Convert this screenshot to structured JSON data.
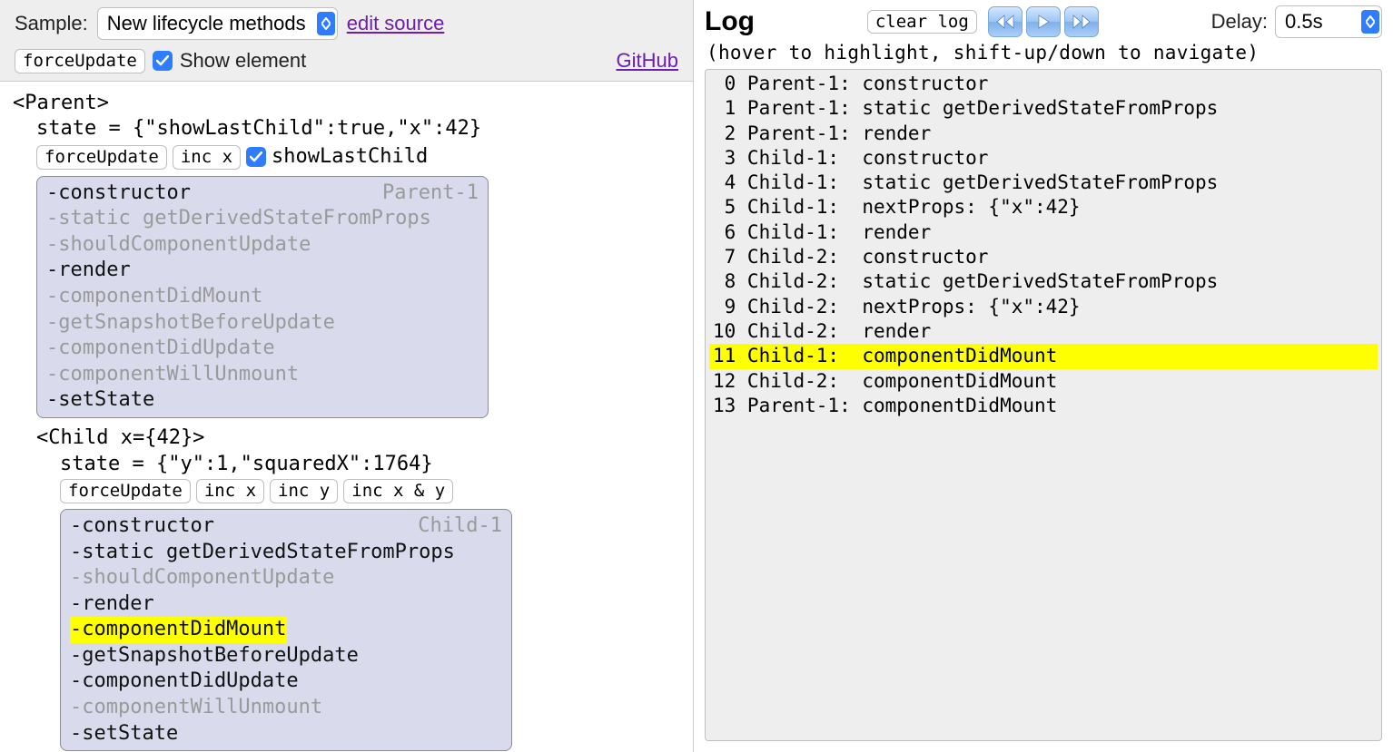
{
  "header": {
    "sample_label": "Sample:",
    "sample_value": "New lifecycle methods",
    "edit_source": "edit source",
    "force_update_btn": "forceUpdate",
    "show_element_label": "Show element",
    "github_link": "GitHub"
  },
  "tree": {
    "parent_open": "<Parent>",
    "parent_state": "state = {\"showLastChild\":true,\"x\":42}",
    "parent_force_update": "forceUpdate",
    "parent_inc_x": "inc x",
    "parent_show_last_child_label": "showLastChild",
    "parent_box_label": "Parent-1",
    "parent_methods": [
      {
        "text": "-constructor",
        "dim": false
      },
      {
        "text": "-static getDerivedStateFromProps",
        "dim": true
      },
      {
        "text": "-shouldComponentUpdate",
        "dim": true
      },
      {
        "text": "-render",
        "dim": false
      },
      {
        "text": "-componentDidMount",
        "dim": true
      },
      {
        "text": "-getSnapshotBeforeUpdate",
        "dim": true
      },
      {
        "text": "-componentDidUpdate",
        "dim": true
      },
      {
        "text": "-componentWillUnmount",
        "dim": true
      },
      {
        "text": "-setState",
        "dim": false
      }
    ],
    "child_open": "<Child x={42}>",
    "child_state": "state = {\"y\":1,\"squaredX\":1764}",
    "child_force_update": "forceUpdate",
    "child_inc_x": "inc x",
    "child_inc_y": "inc y",
    "child_inc_xy": "inc x & y",
    "child_box_label": "Child-1",
    "child_methods": [
      {
        "text": "-constructor",
        "dim": false,
        "hl": false
      },
      {
        "text": "-static getDerivedStateFromProps",
        "dim": false,
        "hl": false
      },
      {
        "text": "-shouldComponentUpdate",
        "dim": true,
        "hl": false
      },
      {
        "text": "-render",
        "dim": false,
        "hl": false
      },
      {
        "text": "-componentDidMount",
        "dim": false,
        "hl": true
      },
      {
        "text": "-getSnapshotBeforeUpdate",
        "dim": false,
        "hl": false
      },
      {
        "text": "-componentDidUpdate",
        "dim": false,
        "hl": false
      },
      {
        "text": "-componentWillUnmount",
        "dim": true,
        "hl": false
      },
      {
        "text": "-setState",
        "dim": false,
        "hl": false
      }
    ]
  },
  "log": {
    "title": "Log",
    "clear_btn": "clear log",
    "delay_label": "Delay:",
    "delay_value": "0.5s",
    "hint": "(hover to highlight, shift-up/down to navigate)",
    "entries": [
      {
        "n": 0,
        "comp": "Parent-1:",
        "msg": "constructor",
        "hl": false
      },
      {
        "n": 1,
        "comp": "Parent-1:",
        "msg": "static getDerivedStateFromProps",
        "hl": false
      },
      {
        "n": 2,
        "comp": "Parent-1:",
        "msg": "render",
        "hl": false
      },
      {
        "n": 3,
        "comp": "Child-1: ",
        "msg": "constructor",
        "hl": false
      },
      {
        "n": 4,
        "comp": "Child-1: ",
        "msg": "static getDerivedStateFromProps",
        "hl": false
      },
      {
        "n": 5,
        "comp": "Child-1: ",
        "msg": "nextProps: {\"x\":42}",
        "hl": false
      },
      {
        "n": 6,
        "comp": "Child-1: ",
        "msg": "render",
        "hl": false
      },
      {
        "n": 7,
        "comp": "Child-2: ",
        "msg": "constructor",
        "hl": false
      },
      {
        "n": 8,
        "comp": "Child-2: ",
        "msg": "static getDerivedStateFromProps",
        "hl": false
      },
      {
        "n": 9,
        "comp": "Child-2: ",
        "msg": "nextProps: {\"x\":42}",
        "hl": false
      },
      {
        "n": 10,
        "comp": "Child-2: ",
        "msg": "render",
        "hl": false
      },
      {
        "n": 11,
        "comp": "Child-1: ",
        "msg": "componentDidMount",
        "hl": true
      },
      {
        "n": 12,
        "comp": "Child-2: ",
        "msg": "componentDidMount",
        "hl": false
      },
      {
        "n": 13,
        "comp": "Parent-1:",
        "msg": "componentDidMount",
        "hl": false
      }
    ]
  }
}
